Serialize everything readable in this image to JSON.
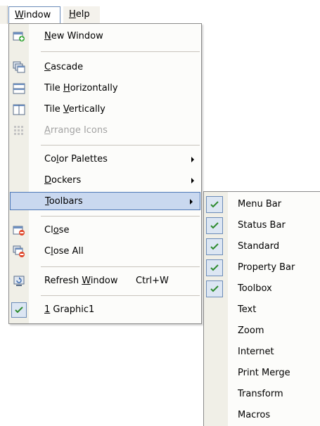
{
  "menubar": {
    "window": {
      "pre": "",
      "key": "W",
      "post": "indow"
    },
    "help": {
      "pre": "",
      "key": "H",
      "post": "elp"
    }
  },
  "window_menu": {
    "new_window": {
      "pre": "",
      "key": "N",
      "post": "ew Window"
    },
    "cascade": {
      "pre": "",
      "key": "C",
      "post": "ascade"
    },
    "tile_horizontally": {
      "pre": "Tile ",
      "key": "H",
      "post": "orizontally"
    },
    "tile_vertically": {
      "pre": "Tile ",
      "key": "V",
      "post": "ertically"
    },
    "arrange_icons": {
      "pre": "",
      "key": "A",
      "post": "rrange Icons"
    },
    "color_palettes": {
      "pre": "Co",
      "key": "l",
      "post": "or Palettes"
    },
    "dockers": {
      "pre": "",
      "key": "D",
      "post": "ockers"
    },
    "toolbars": {
      "pre": "",
      "key": "T",
      "post": "oolbars"
    },
    "close": {
      "pre": "Cl",
      "key": "o",
      "post": "se"
    },
    "close_all": {
      "pre": "C",
      "key": "l",
      "post": "ose All"
    },
    "refresh_window": {
      "pre": "Refresh ",
      "key": "W",
      "post": "indow"
    },
    "refresh_shortcut": "Ctrl+W",
    "graphic": {
      "pre": "",
      "key": "1",
      "post": " Graphic1"
    }
  },
  "toolbars_submenu": [
    {
      "label": "Menu Bar",
      "checked": true
    },
    {
      "label": "Status Bar",
      "checked": true
    },
    {
      "label": "Standard",
      "checked": true
    },
    {
      "label": "Property Bar",
      "checked": true
    },
    {
      "label": "Toolbox",
      "checked": true
    },
    {
      "label": "Text",
      "checked": false
    },
    {
      "label": "Zoom",
      "checked": false
    },
    {
      "label": "Internet",
      "checked": false
    },
    {
      "label": "Print Merge",
      "checked": false
    },
    {
      "label": "Transform",
      "checked": false
    },
    {
      "label": "Macros",
      "checked": false
    }
  ],
  "colors": {
    "highlight": "#c9d8ef",
    "highlight_border": "#4d78b7",
    "check": "#2e8b2e",
    "disabled_text": "#a3a3a3"
  }
}
